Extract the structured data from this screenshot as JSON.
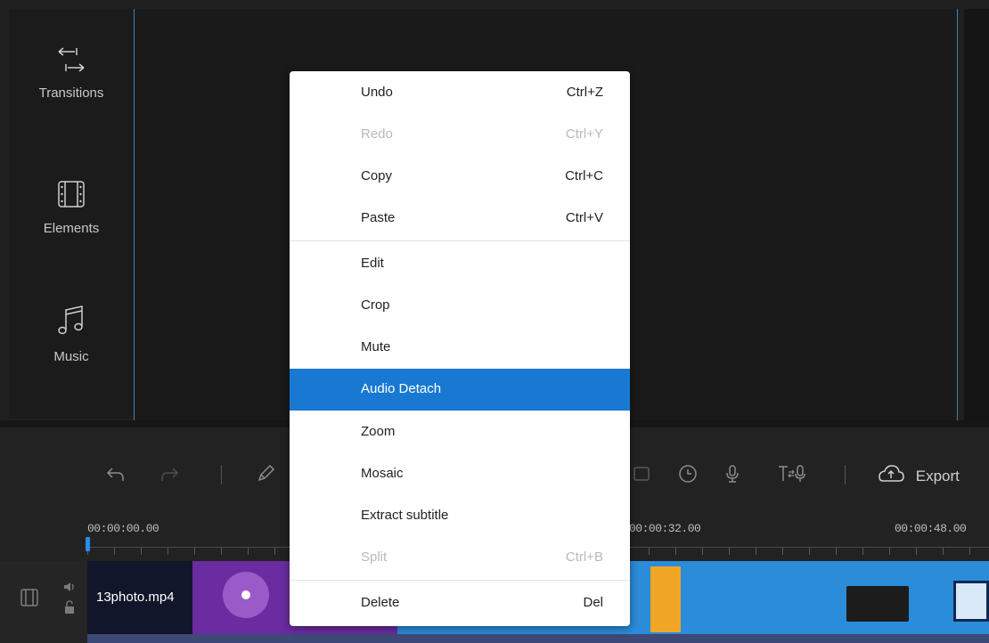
{
  "sidebar": {
    "items": [
      {
        "label": "Transitions",
        "icon": "transitions-icon"
      },
      {
        "label": "Elements",
        "icon": "film-frame-icon"
      },
      {
        "label": "Music",
        "icon": "music-note-icon"
      }
    ]
  },
  "toolbar": {
    "export_label": "Export"
  },
  "ruler": {
    "timecodes": [
      "00:00:00.00",
      "00:00:32.00",
      "00:00:48.00"
    ]
  },
  "track": {
    "clip_name": "13photo.mp4"
  },
  "context_menu": {
    "items": [
      {
        "label": "Undo",
        "shortcut": "Ctrl+Z",
        "state": "enabled"
      },
      {
        "label": "Redo",
        "shortcut": "Ctrl+Y",
        "state": "disabled"
      },
      {
        "label": "Copy",
        "shortcut": "Ctrl+C",
        "state": "enabled"
      },
      {
        "label": "Paste",
        "shortcut": "Ctrl+V",
        "state": "enabled"
      },
      {
        "label": "Edit",
        "shortcut": "",
        "state": "enabled"
      },
      {
        "label": "Crop",
        "shortcut": "",
        "state": "enabled"
      },
      {
        "label": "Mute",
        "shortcut": "",
        "state": "enabled"
      },
      {
        "label": "Audio Detach",
        "shortcut": "",
        "state": "selected"
      },
      {
        "label": "Zoom",
        "shortcut": "",
        "state": "enabled"
      },
      {
        "label": "Mosaic",
        "shortcut": "",
        "state": "enabled"
      },
      {
        "label": "Extract subtitle",
        "shortcut": "",
        "state": "enabled"
      },
      {
        "label": "Split",
        "shortcut": "Ctrl+B",
        "state": "disabled"
      },
      {
        "label": "Delete",
        "shortcut": "Del",
        "state": "enabled"
      }
    ]
  },
  "colors": {
    "accent": "#1979d2",
    "workspace_bg": "#1f1f1f",
    "clip_purple": "#6a2ca0",
    "clip_blue": "#2b8cd9"
  }
}
